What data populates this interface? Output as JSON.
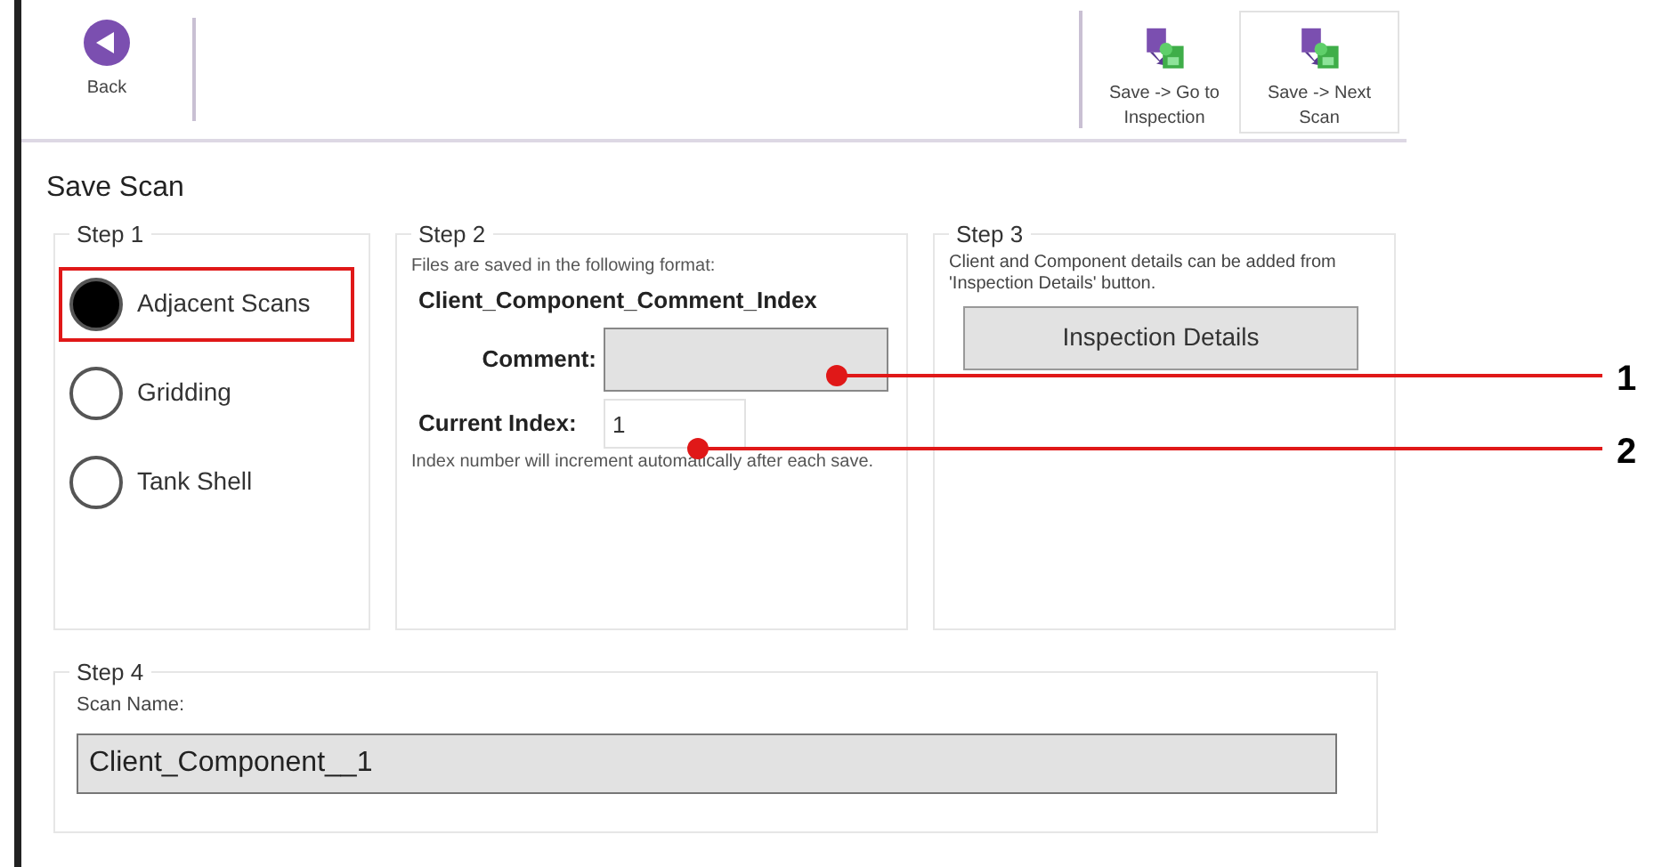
{
  "toolbar": {
    "back": "Back",
    "actions": [
      {
        "label": "Save -> Go to Inspection",
        "selected": false
      },
      {
        "label": "Save -> Next Scan",
        "selected": true
      }
    ]
  },
  "title": "Save Scan",
  "step1": {
    "legend": "Step 1",
    "options": [
      {
        "label": "Adjacent Scans",
        "selected": true,
        "highlighted": true
      },
      {
        "label": "Gridding",
        "selected": false,
        "highlighted": false
      },
      {
        "label": "Tank Shell",
        "selected": false,
        "highlighted": false
      }
    ]
  },
  "step2": {
    "legend": "Step 2",
    "intro": "Files are saved in the following format:",
    "format": "Client_Component_Comment_Index",
    "comment_label": "Comment:",
    "index_label": "Current Index:",
    "index_value": "1",
    "note": "Index number will increment automatically after each save."
  },
  "step3": {
    "legend": "Step 3",
    "text": "Client and Component details can be added from 'Inspection Details' button.",
    "button": "Inspection Details"
  },
  "step4": {
    "legend": "Step 4",
    "label": "Scan Name:",
    "value": "Client_Component__1"
  },
  "callouts": [
    {
      "label": "1"
    },
    {
      "label": "2"
    }
  ]
}
